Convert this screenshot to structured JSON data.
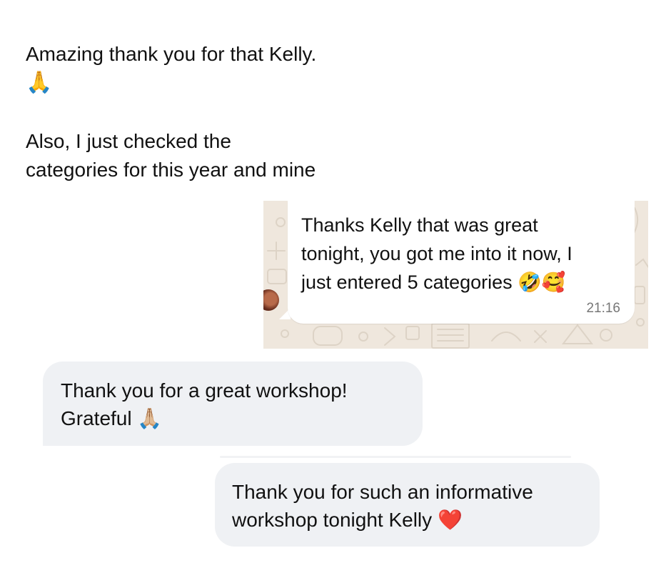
{
  "message_1": {
    "line_1": "Amazing thank you for that Kelly.",
    "emoji": "🙏",
    "line_2": "Also, I just checked the",
    "line_3": "categories for this year and mine"
  },
  "whatsapp_message": {
    "line_1": "Thanks Kelly that was great",
    "line_2": "tonight, you got me into it now, I",
    "line_3": "just entered 5 categories",
    "emoji_1": "🤣",
    "emoji_2": "🥰",
    "time": "21:16"
  },
  "message_3": {
    "line_1": "Thank you for a great workshop!",
    "line_2": "Grateful",
    "emoji": "🙏🏼"
  },
  "message_4": {
    "line_1": "Thank you for such an informative",
    "line_2": "workshop tonight Kelly",
    "emoji": "❤️"
  },
  "colors": {
    "page_background": "#ffffff",
    "bubble_grey": "#eff1f4",
    "whatsapp_background": "#efe7dd",
    "whatsapp_bubble": "#ffffff",
    "timestamp": "#777777",
    "text": "#111111"
  }
}
